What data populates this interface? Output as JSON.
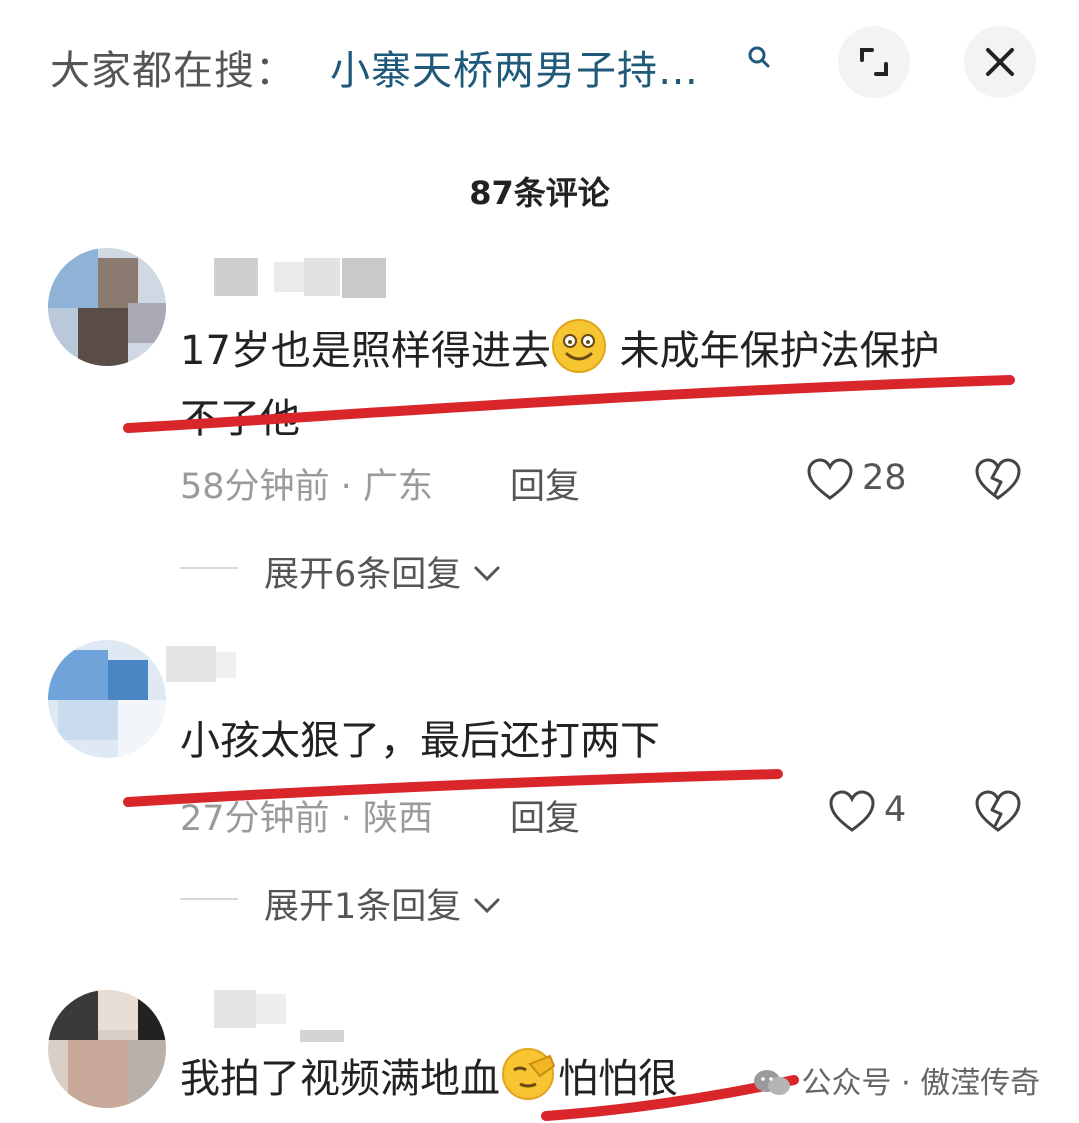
{
  "header": {
    "search_prefix": "大家都在搜：",
    "search_query": "小寨天桥两男子持…",
    "comment_count_title": "87条评论"
  },
  "comments": [
    {
      "text_line1": "17岁也是照样得进去",
      "text_after_emoji": " 未成年保护法保护",
      "text_line2": "不了他",
      "emoji": "smile-emoji",
      "time_location": "58分钟前 · 广东",
      "reply_label": "回复",
      "likes": "28",
      "expand_replies": "展开6条回复"
    },
    {
      "text_line1": "小孩太狠了，最后还打两下",
      "time_location": "27分钟前 · 陕西",
      "reply_label": "回复",
      "likes": "4",
      "expand_replies": "展开1条回复"
    },
    {
      "text_line1": "我拍了视频满地血",
      "text_after_emoji": "怕怕很",
      "emoji": "facepalm-emoji"
    }
  ],
  "watermark": "公众号 · 傲滢传奇",
  "colors": {
    "underline": "#d8262b",
    "query": "#1f5a7a"
  }
}
